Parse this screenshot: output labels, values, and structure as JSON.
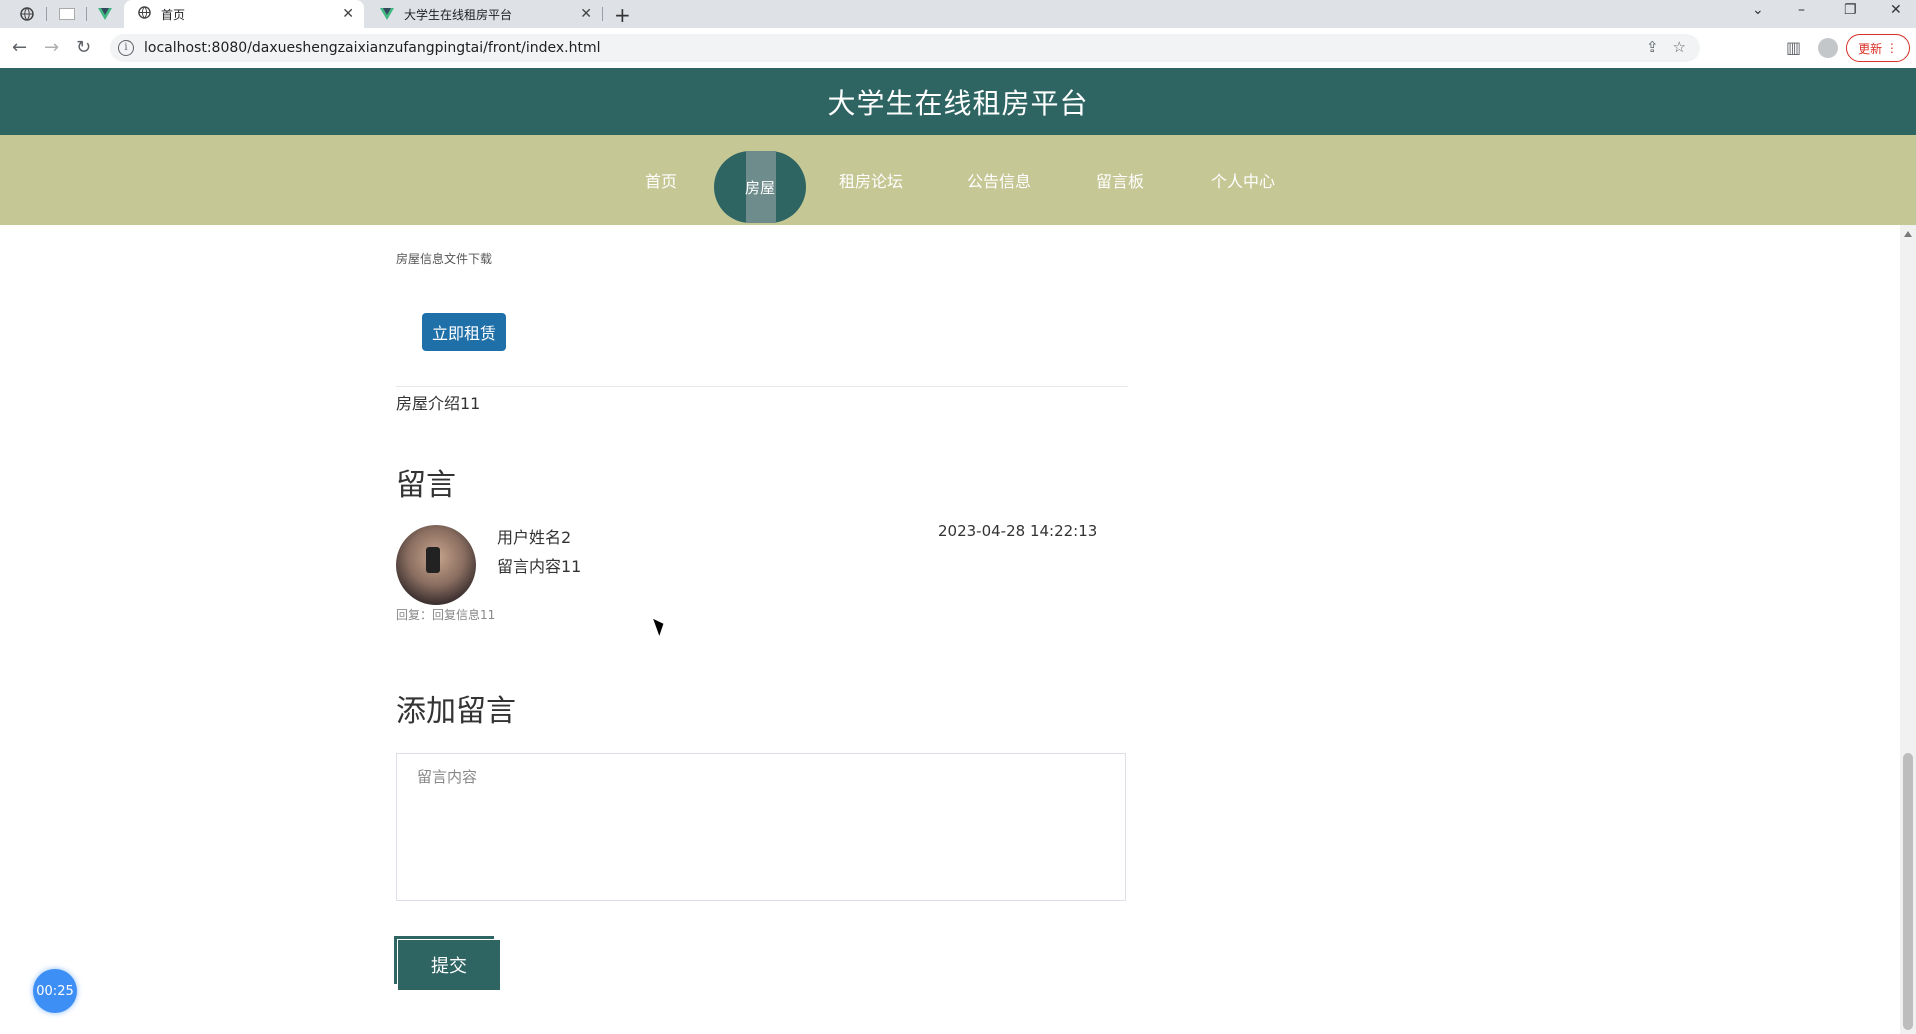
{
  "browser": {
    "tabs": [
      {
        "title": "首页",
        "active": true
      },
      {
        "title": "大学生在线租房平台",
        "active": false
      }
    ],
    "url": "localhost:8080/daxueshengzaixianzufangpingtai/front/index.html",
    "update_label": "更新"
  },
  "site": {
    "title": "大学生在线租房平台",
    "nav": [
      "首页",
      "房屋",
      "租房论坛",
      "公告信息",
      "留言板",
      "个人中心"
    ],
    "active_nav": "房屋"
  },
  "house": {
    "file_download": "房屋信息文件下载",
    "rent_button": "立即租赁",
    "intro": "房屋介绍11"
  },
  "comments": {
    "heading": "留言",
    "items": [
      {
        "user": "用户姓名2",
        "content": "留言内容11",
        "time": "2023-04-28 14:22:13",
        "reply": "回复：回复信息11"
      }
    ]
  },
  "add_comment": {
    "heading": "添加留言",
    "placeholder": "留言内容",
    "submit_label": "提交"
  },
  "timer": "00:25"
}
